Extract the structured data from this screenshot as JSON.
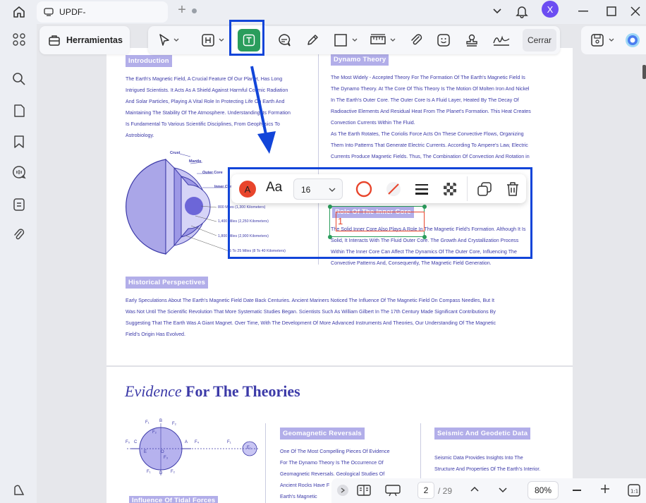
{
  "tab": {
    "title": "UPDF-"
  },
  "user": {
    "initial": "X"
  },
  "toolbar": {
    "tools_label": "Herramientas",
    "close_label": "Cerrar"
  },
  "floating_toolbar": {
    "font_size": "16",
    "font_label": "Aa"
  },
  "doc": {
    "intro": {
      "heading": "Introduction",
      "lines": [
        "The Earth's Magnetic Field, A Crucial Feature Of Our Planet, Has Long",
        "Intrigued Scientists. It Acts As A Shield Against Harmful Cosmic Radiation",
        "And Solar Particles, Playing A Vital Role In Protecting Life On Earth And",
        "Maintaining The Stability Of The Atmosphere. Understanding Its Formation",
        "Is Fundamental To Various Scientific Disciplines, From Geophysics To",
        "Astrobiology."
      ]
    },
    "diagram": {
      "labels": {
        "crust": "Crust",
        "mantle": "Mantle",
        "outer": "Outer Core",
        "inner": "Inner Core"
      },
      "distances": [
        "800 Miles (1,300 Kilometers)",
        "1,400 Miles (2,250 Kilometers)",
        "1,800 Miles (2,900 Kilometers)",
        "5 To 25 Miles (8 To 40 Kilometers)"
      ]
    },
    "dynamo": {
      "heading": "Dynamo Theory",
      "lines": [
        "The Most Widely - Accepted Theory For The Formation Of The Earth's Magnetic Field Is",
        "The Dynamo Theory. At The Core Of This Theory Is The Motion Of Molten Iron And Nickel",
        "In The Earth's Outer Core. The Outer Core Is A Fluid Layer, Heated By The Decay Of",
        "Radioactive Elements And Residual Heat From The Planet's Formation. This Heat Creates",
        "Convection Currents Within The Fluid.",
        "As The Earth Rotates, The Coriolis Force Acts On These Convective Flows, Organizing",
        "Them Into Patterns That Generate Electric Currents. According To Ampere's Law, Electric",
        "Currents Produce Magnetic Fields. Thus, The Combination Of Convection And Rotation in"
      ]
    },
    "inner_core": {
      "heading": "Role Of The Inner Core",
      "textbox_value": "1",
      "lines": [
        "The Solid Inner Core Also Plays A Role In The Magnetic Field's Formation. Although It Is",
        "Solid, It Interacts With The Fluid Outer Core. The Growth And Crystallization Process",
        "Within The Inner Core Can Affect The Dynamics Of The Outer Core, Influencing The",
        "Convective Patterns And, Consequently, The Magnetic Field Generation."
      ]
    },
    "historical": {
      "heading": "Historical Perspectives",
      "lines": [
        "Early Speculations About The Earth's Magnetic Field Date Back Centuries. Ancient Mariners Noticed The Influence Of The Magnetic Field On Compass Needles, But It",
        "Was Not Until The Scientific Revolution That More Systematic Studies Began. Scientists Such As William Gilbert In The 17th Century Made Significant Contributions By",
        "Suggesting That The Earth Was A Giant Magnet. Over Time, With The Development Of More Advanced Instruments And Theories, Our Understanding Of The Magnetic",
        "Field's Origin Has Evolved."
      ]
    },
    "evidence": {
      "title_italic": "Evidence",
      "title_bold": "For The Theories"
    },
    "geomagnetic": {
      "heading": "Geomagnetic Reversals",
      "lines": [
        "One Of The Most Compelling Pieces Of Evidence",
        "For The Dynamo Theory Is The Occurrence Of",
        "Geomagnetic Reversals. Geological Studies Of",
        "Ancient Rocks Have F",
        "Earth's Magnetic"
      ]
    },
    "seismic": {
      "heading": "Seismic And Geodetic Data",
      "lines": [
        "Seismic Data Provides Insights Into The",
        "Structure And Properties Of The Earth's Interior."
      ]
    },
    "tidal": {
      "heading": "Influence Of Tidal Forces"
    },
    "force_diagram": {
      "labels": [
        "F₁",
        "B",
        "F₂",
        "F₂",
        "C",
        "F₀",
        "E",
        "A",
        "F₄",
        "O",
        "F₃",
        "F₁",
        "D",
        "F₂",
        "F₁",
        "E₁"
      ]
    }
  },
  "bottombar": {
    "current_page": "2",
    "total_pages": "/ 29",
    "zoom": "80%"
  },
  "colors": {
    "accent": "#1245d9",
    "heading_bg": "#b2aee9",
    "text_blue": "#3c3aa8",
    "active_tool": "#2a9d5c",
    "red": "#e8452c"
  }
}
